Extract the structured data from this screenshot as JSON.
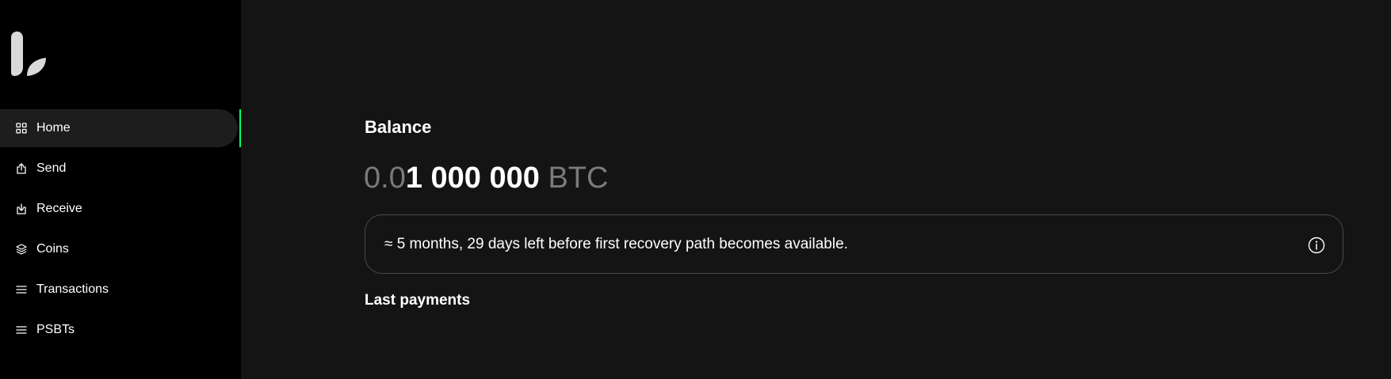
{
  "sidebar": {
    "logo_icon": "leaf-logo-icon",
    "active_indicator_color": "#00ff66",
    "items": [
      {
        "label": "Home",
        "icon": "grid-icon",
        "active": true
      },
      {
        "label": "Send",
        "icon": "upload-icon",
        "active": false
      },
      {
        "label": "Receive",
        "icon": "download-icon",
        "active": false
      },
      {
        "label": "Coins",
        "icon": "layers-icon",
        "active": false
      },
      {
        "label": "Transactions",
        "icon": "list-icon",
        "active": false
      },
      {
        "label": "PSBTs",
        "icon": "list-icon",
        "active": false
      }
    ]
  },
  "main": {
    "balance_title": "Balance",
    "balance": {
      "prefix": "0.0",
      "main": "1 000 000",
      "unit": "BTC"
    },
    "notice": {
      "text": "≈ 5 months, 29 days left before first recovery path becomes available.",
      "icon": "info-icon"
    },
    "last_payments_title": "Last payments"
  }
}
